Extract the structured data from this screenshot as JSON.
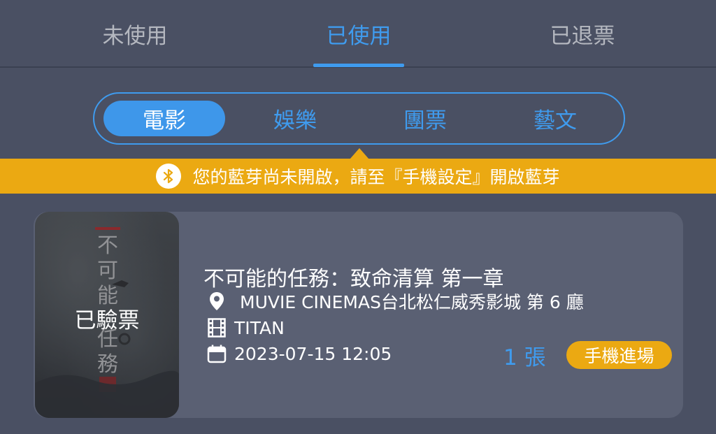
{
  "tabs": [
    {
      "label": "未使用"
    },
    {
      "label": "已使用",
      "active": true
    },
    {
      "label": "已退票"
    }
  ],
  "categories": [
    {
      "label": "電影",
      "active": true
    },
    {
      "label": "娛樂"
    },
    {
      "label": "團票"
    },
    {
      "label": "藝文"
    }
  ],
  "banner": {
    "icon": "bluetooth-icon",
    "text": "您的藍芽尚未開啟，請至『手機設定』開啟藍芽"
  },
  "ticket": {
    "poster_icon": "movie-poster",
    "status": "已驗票",
    "title": "不可能的任務：致命清算 第一章",
    "cinema": "MUVIE CINEMAS台北松仁威秀影城 第 6 廳",
    "format": "TITAN",
    "datetime": "2023-07-15 12:05",
    "count": "1 張",
    "entry_label": "手機進場"
  },
  "colors": {
    "background": "#4a5063",
    "accent": "#3f9bee",
    "warning": "#eba912",
    "card": "#5a6073"
  }
}
